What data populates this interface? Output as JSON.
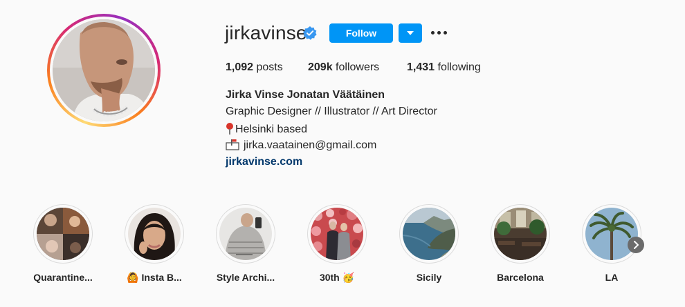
{
  "profile": {
    "username": "jirkavinse",
    "verified_icon": "verified-badge-icon",
    "follow_label": "Follow",
    "dropdown_icon": "chevron-down-icon",
    "more_icon": "more-options-icon",
    "accent_color": "#0095f6"
  },
  "stats": {
    "posts_count": "1,092",
    "posts_label": "posts",
    "followers_count": "209k",
    "followers_label": "followers",
    "following_count": "1,431",
    "following_label": "following"
  },
  "bio": {
    "full_name": "Jirka Vinse Jonatan Väätäinen",
    "line1": "Graphic Designer // Illustrator // Art Director",
    "line2": "Helsinki based",
    "line3": "jirka.vaatainen@gmail.com",
    "website": "jirkavinse.com",
    "pin_icon": "round-pushpin-icon",
    "mail_icon": "mailbox-icon"
  },
  "highlights": [
    {
      "label": "Quarantine..."
    },
    {
      "label": "🙆 Insta B..."
    },
    {
      "label": "Style Archi..."
    },
    {
      "label": "30th 🥳"
    },
    {
      "label": "Sicily"
    },
    {
      "label": "Barcelona"
    },
    {
      "label": "LA"
    }
  ],
  "highlights_next_icon": "chevron-right-icon"
}
